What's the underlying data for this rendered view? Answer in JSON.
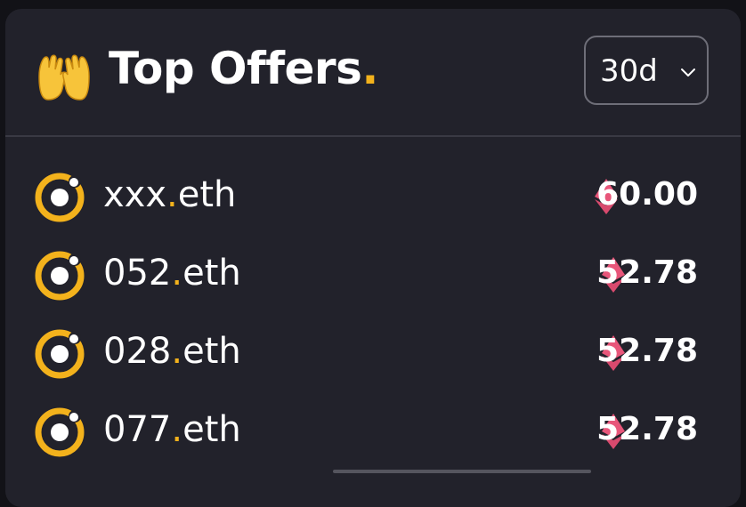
{
  "header": {
    "icon": "palms-up-together-icon",
    "title": "Top Offers",
    "title_dot": "."
  },
  "period": {
    "selected": "30d",
    "icon": "chevron-down-icon"
  },
  "offers": [
    {
      "name": "xxx",
      "suffix": ".eth",
      "price": "60.00"
    },
    {
      "name": "052",
      "suffix": ".eth",
      "price": "52.78"
    },
    {
      "name": "028",
      "suffix": ".eth",
      "price": "52.78"
    },
    {
      "name": "077",
      "suffix": ".eth",
      "price": "52.78"
    }
  ],
  "colors": {
    "background": "#22222b",
    "accent": "#f3b21c",
    "eth": "#e8567a",
    "text": "#ffffff"
  }
}
